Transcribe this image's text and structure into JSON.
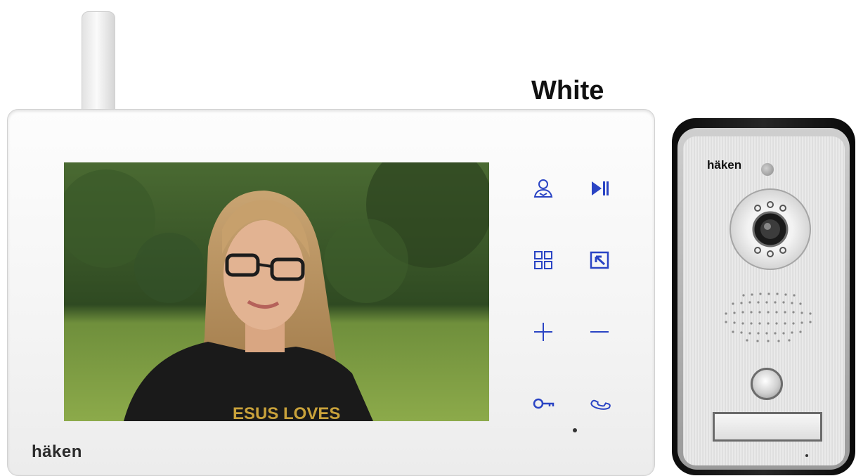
{
  "product": {
    "color_label": "White"
  },
  "monitor": {
    "brand": "häken",
    "buttons": [
      {
        "name": "intercom-user-button",
        "icon": "user-icon"
      },
      {
        "name": "play-pause-button",
        "icon": "play-pause-icon"
      },
      {
        "name": "menu-grid-button",
        "icon": "grid-icon"
      },
      {
        "name": "monitor-view-button",
        "icon": "monitor-arrow-icon"
      },
      {
        "name": "volume-up-button",
        "icon": "plus-icon"
      },
      {
        "name": "volume-down-button",
        "icon": "minus-icon"
      },
      {
        "name": "unlock-button",
        "icon": "key-icon"
      },
      {
        "name": "answer-call-button",
        "icon": "phone-icon"
      }
    ],
    "button_color": "#2a44c4"
  },
  "door_station": {
    "brand": "häken"
  }
}
